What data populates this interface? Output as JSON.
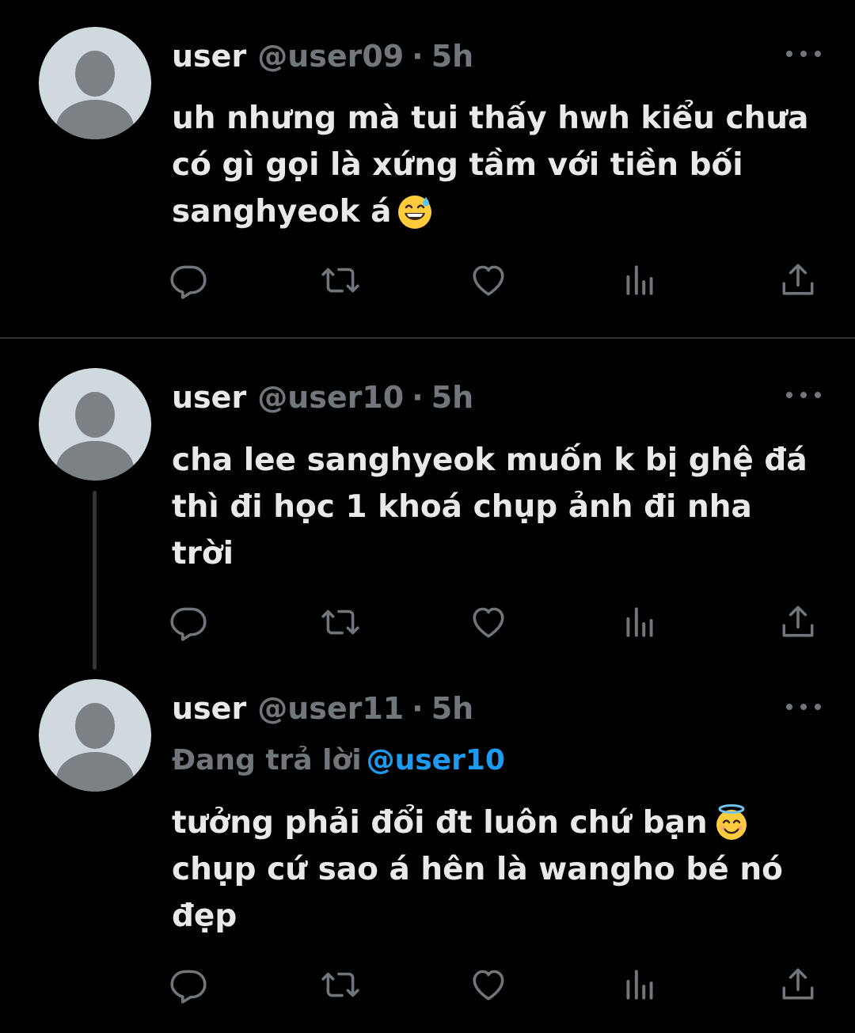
{
  "colors": {
    "background": "#000000",
    "text": "#e7e9ea",
    "muted": "#71767b",
    "accent": "#1d9bf0",
    "divider": "#2f3336"
  },
  "tweets": [
    {
      "name": "user",
      "handle": "@user09",
      "separator": "·",
      "time": "5h",
      "text": "uh nhưng mà tui thấy hwh kiểu chưa\ncó gì gọi là xứng tầm với tiền bối\nsanghyeok á",
      "emoji": "grinning-sweat-emoji"
    },
    {
      "name": "user",
      "handle": "@user10",
      "separator": "·",
      "time": "5h",
      "text": "cha lee sanghyeok muốn k bị ghệ đá\nthì đi học 1 khoá chụp ảnh đi nha\ntrời"
    },
    {
      "name": "user",
      "handle": "@user11",
      "separator": "·",
      "time": "5h",
      "replying_label": "Đang trả lời",
      "replying_to": "@user10",
      "text_line1": "tưởng phải đổi đt luôn chứ bạn",
      "text_rest": "chụp cứ sao á hên là wangho bé nó\nđẹp",
      "emoji": "smiling-halo-emoji"
    }
  ],
  "action_icons": [
    "reply-icon",
    "retweet-icon",
    "like-icon",
    "views-icon",
    "share-icon"
  ]
}
